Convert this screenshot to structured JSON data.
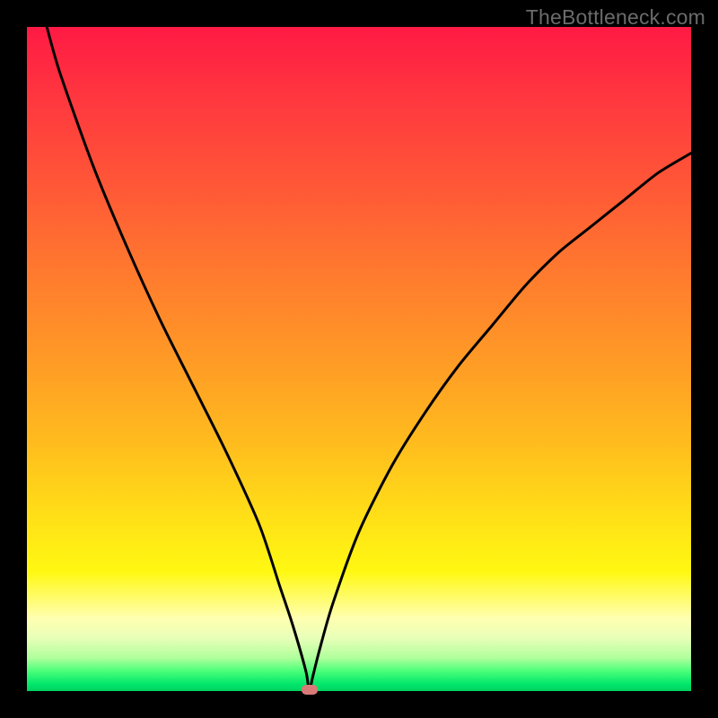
{
  "watermark": "TheBottleneck.com",
  "chart_data": {
    "type": "line",
    "title": "",
    "xlabel": "",
    "ylabel": "",
    "xlim": [
      0,
      100
    ],
    "ylim": [
      0,
      100
    ],
    "grid": false,
    "legend": false,
    "note": "V-shaped bottleneck curve on rainbow gradient; minimum near x≈42.5, y≈0. Values are estimated percentages along each axis read from the plotted curve.",
    "series": [
      {
        "name": "bottleneck-curve",
        "x": [
          3,
          5,
          10,
          15,
          20,
          25,
          30,
          35,
          38,
          40,
          42,
          42.5,
          43,
          44,
          46,
          50,
          55,
          60,
          65,
          70,
          75,
          80,
          85,
          90,
          95,
          100
        ],
        "y": [
          100,
          93,
          79,
          67,
          56,
          46,
          36,
          25,
          16,
          10,
          3,
          0,
          2,
          6,
          13,
          24,
          34,
          42,
          49,
          55,
          61,
          66,
          70,
          74,
          78,
          81
        ]
      }
    ],
    "marker": {
      "x": 42.5,
      "y": 0,
      "color": "#d97a78"
    },
    "gradient_colors": [
      "#ff1a44",
      "#ff7a2e",
      "#ffe017",
      "#00d060"
    ]
  }
}
